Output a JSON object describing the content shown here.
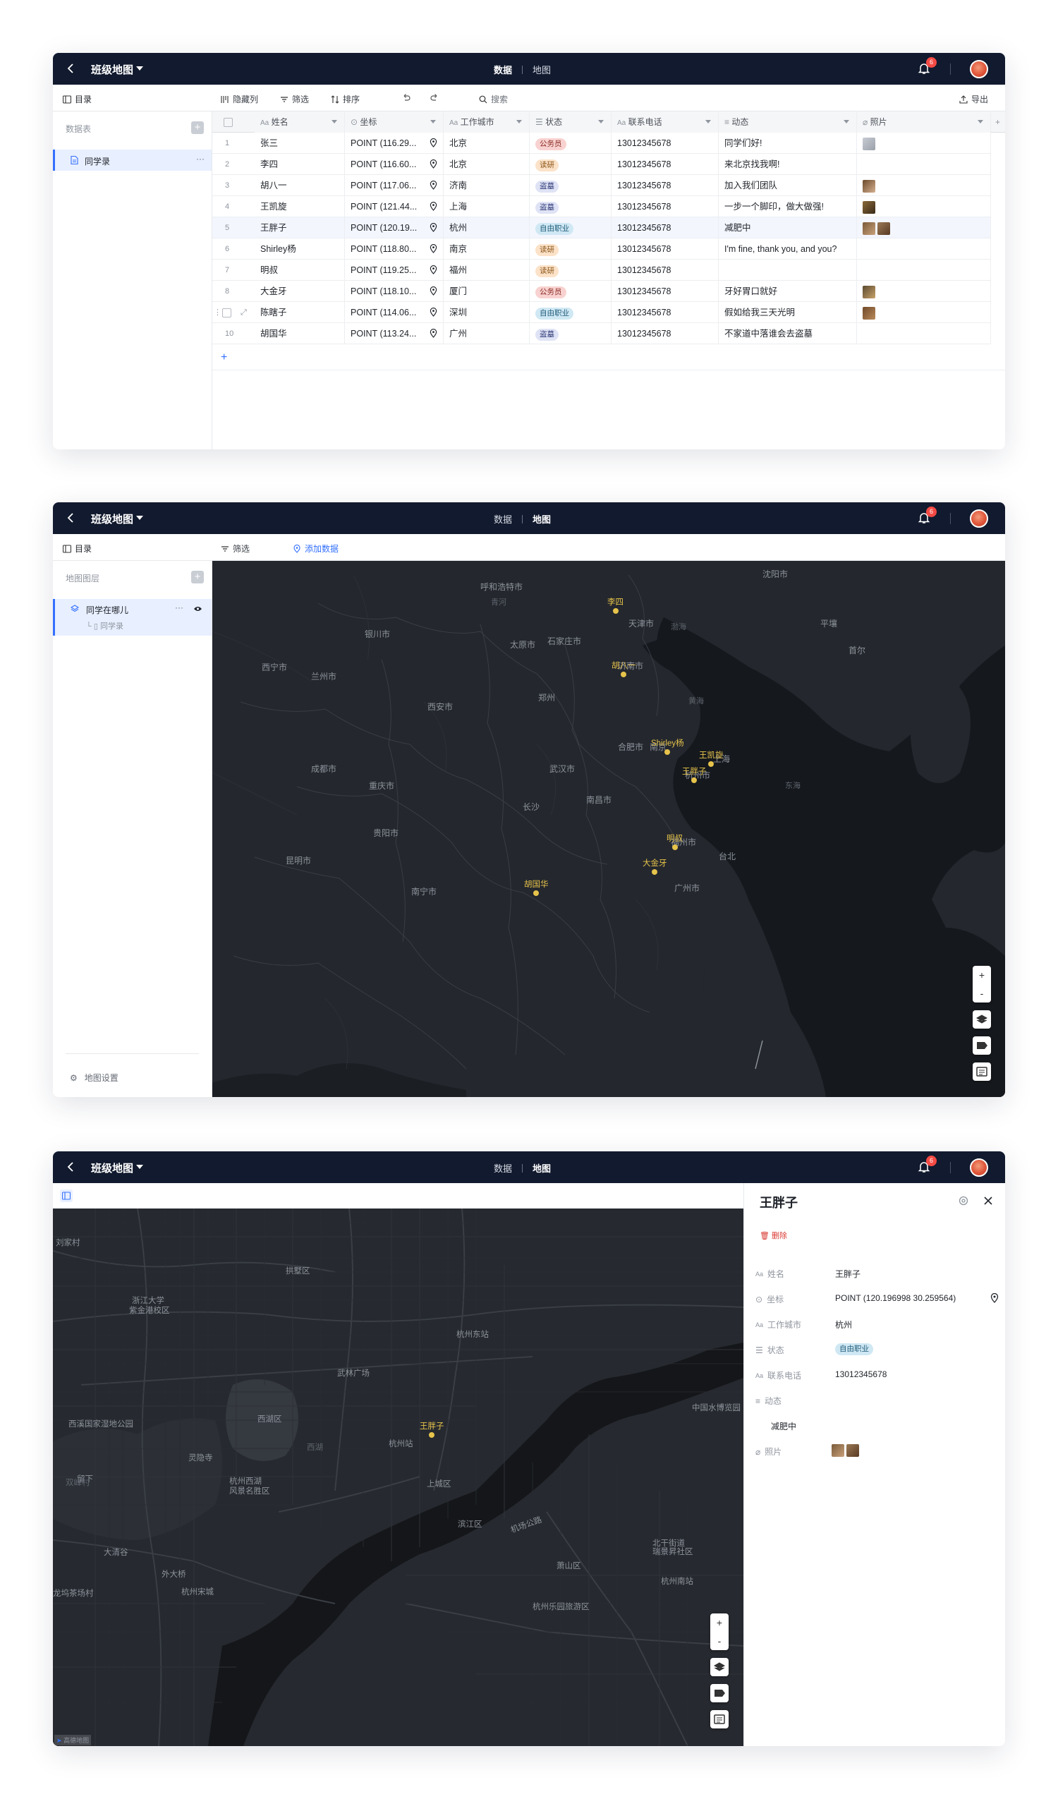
{
  "app": {
    "title": "班级地图",
    "tab_data": "数据",
    "tab_map": "地图",
    "notifications": "6"
  },
  "toolbar": {
    "catalog": "目录",
    "hide_cols": "隐藏列",
    "filter": "筛选",
    "sort": "排序",
    "search": "搜索",
    "export": "导出",
    "add_data": "添加数据"
  },
  "sidebar1": {
    "section": "数据表",
    "item": "同学录",
    "more": "···",
    "add": "+"
  },
  "sidebar2": {
    "section": "地图图层",
    "layer": "同学在哪儿",
    "sublayer": "同学录",
    "more": "···",
    "settings": "地图设置",
    "add": "+"
  },
  "table": {
    "headers": {
      "name": "姓名",
      "coord": "坐标",
      "city": "工作城市",
      "status": "状态",
      "phone": "联系电话",
      "moment": "动态",
      "photo": "照片"
    },
    "add_row": "+",
    "add_col": "+",
    "rows": [
      {
        "no": "1",
        "name": "张三",
        "coord": "POINT (116.29...",
        "city": "北京",
        "status": "公务员",
        "phone": "13012345678",
        "moment": "同学们好!"
      },
      {
        "no": "2",
        "name": "李四",
        "coord": "POINT (116.60...",
        "city": "北京",
        "status": "读研",
        "phone": "13012345678",
        "moment": "来北京找我啊!"
      },
      {
        "no": "3",
        "name": "胡八一",
        "coord": "POINT (117.06...",
        "city": "济南",
        "status": "盗墓",
        "phone": "13012345678",
        "moment": "加入我们团队"
      },
      {
        "no": "4",
        "name": "王凯旋",
        "coord": "POINT (121.44...",
        "city": "上海",
        "status": "盗墓",
        "phone": "13012345678",
        "moment": "一步一个脚印，做大做强!"
      },
      {
        "no": "5",
        "name": "王胖子",
        "coord": "POINT (120.19...",
        "city": "杭州",
        "status": "自由职业",
        "phone": "13012345678",
        "moment": "减肥中"
      },
      {
        "no": "6",
        "name": "Shirley杨",
        "coord": "POINT (118.80...",
        "city": "南京",
        "status": "读研",
        "phone": "13012345678",
        "moment": "I'm fine, thank you, and you?"
      },
      {
        "no": "7",
        "name": "明叔",
        "coord": "POINT (119.25...",
        "city": "福州",
        "status": "读研",
        "phone": "13012345678",
        "moment": ""
      },
      {
        "no": "8",
        "name": "大金牙",
        "coord": "POINT (118.10...",
        "city": "厦门",
        "status": "公务员",
        "phone": "13012345678",
        "moment": "牙好胃口就好"
      },
      {
        "no": "",
        "name": "陈瞎子",
        "coord": "POINT (114.06...",
        "city": "深圳",
        "status": "自由职业",
        "phone": "13012345678",
        "moment": "假如给我三天光明"
      },
      {
        "no": "10",
        "name": "胡国华",
        "coord": "POINT (113.24...",
        "city": "广州",
        "status": "盗墓",
        "phone": "13012345678",
        "moment": "不家道中落谁会去盗墓"
      }
    ]
  },
  "map1": {
    "cities": [
      "沈阳市",
      "呼和浩特市",
      "天津市",
      "平壤",
      "首尔",
      "银川市",
      "太原市",
      "石家庄市",
      "西宁市",
      "兰州市",
      "济南市",
      "西安市",
      "郑州",
      "合肥市",
      "南京",
      "上海",
      "成都市",
      "武汉市",
      "杭州市",
      "重庆市",
      "南昌市",
      "长沙",
      "贵阳市",
      "福州市",
      "台北",
      "昆明市",
      "南宁市",
      "广州市",
      "黄海",
      "东海",
      "渤海",
      "青河"
    ],
    "markers": [
      "李四",
      "胡八一",
      "Shirley杨",
      "王凯旋",
      "王胖子",
      "明叔",
      "大金牙",
      "胡国华"
    ]
  },
  "map2": {
    "places": [
      "刘家村",
      "拱墅区",
      "浙江大学",
      "紫金港校区",
      "杭州东站",
      "武林广场",
      "西溪国家湿地公园",
      "西湖区",
      "中国水博览园",
      "灵隐寺",
      "杭州站",
      "留下",
      "西湖",
      "杭州西湖",
      "风景名胜区",
      "上城区",
      "双峰村",
      "机场公路",
      "滨江区",
      "大清谷",
      "北干街道",
      "瑞景昇社区",
      "外大桥",
      "萧山区",
      "杭州宋城",
      "杭州南站",
      "龙坞茶场村",
      "杭州乐园旅游区"
    ],
    "marker": "王胖子",
    "attribution": "高德地图"
  },
  "detail": {
    "title": "王胖子",
    "delete": "删除",
    "fields": {
      "name_label": "姓名",
      "name": "王胖子",
      "coord_label": "坐标",
      "coord": "POINT (120.196998 30.259564)",
      "city_label": "工作城市",
      "city": "杭州",
      "status_label": "状态",
      "status": "自由职业",
      "phone_label": "联系电话",
      "phone": "13012345678",
      "moment_label": "动态",
      "moment": "减肥中",
      "photo_label": "照片"
    }
  },
  "colors": {
    "topbar": "#111a2e",
    "accent": "#3370ff",
    "marker": "#e6c34b",
    "map_bg": "#1c1f24"
  }
}
